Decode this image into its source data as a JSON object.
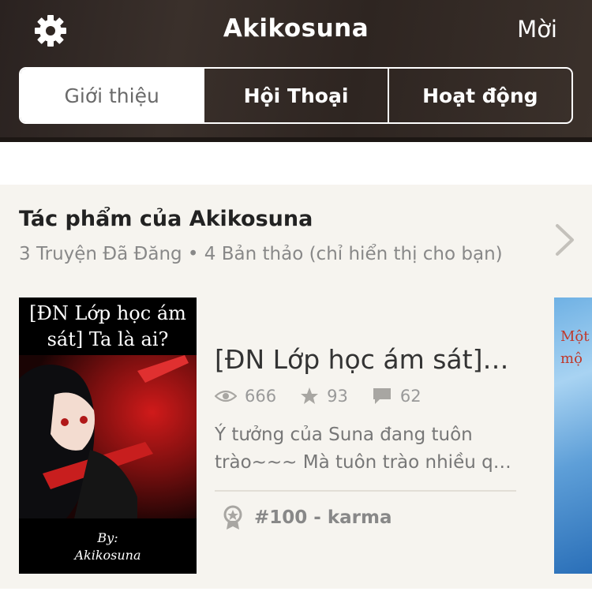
{
  "header": {
    "title": "Akikosuna",
    "invite_label": "Mời",
    "settings_icon": "gear-icon"
  },
  "tabs": [
    {
      "label": "Giới thiệu",
      "active": true
    },
    {
      "label": "Hội Thoại",
      "active": false
    },
    {
      "label": "Hoạt động",
      "active": false
    }
  ],
  "works": {
    "title": "Tác phẩm của Akikosuna",
    "subtitle": "3 Truyện Đã Đăng • 4 Bản thảo (chỉ hiển thị cho bạn)",
    "book": {
      "cover_title": "[ĐN Lớp học ám sát] Ta là ai?",
      "cover_by_line1": "By:",
      "cover_by_line2": "Akikosuna",
      "title": "[ĐN Lớp học ám sát]…",
      "reads": "666",
      "votes": "93",
      "comments": "62",
      "description_line1": "Ý tưởng của Suna đang tuôn",
      "description_line2": "trào~~~ Mà tuôn trào nhiều qu…",
      "rank": "#100 - karma"
    },
    "next_cover_text_line1": "Một",
    "next_cover_text_line2": "mộ"
  },
  "colors": {
    "header_bg": "#2e2521",
    "section_bg": "#f6f4ef",
    "muted_text": "#888888"
  }
}
